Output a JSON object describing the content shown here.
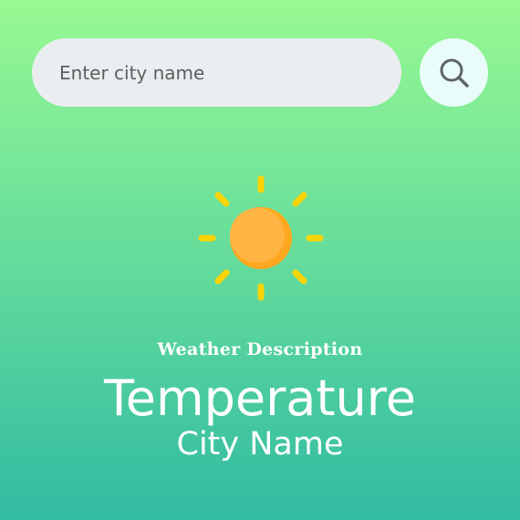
{
  "search": {
    "placeholder": "Enter city name",
    "value": "",
    "button_icon": "search-icon"
  },
  "weather": {
    "icon": "sun-icon",
    "description": "Weather Description",
    "temperature": "Temperature",
    "city": "City Name"
  },
  "colors": {
    "background_top": "#98f991",
    "background_bottom": "#31bba3",
    "input_background": "#eaeef0",
    "button_background": "#e9fcf9",
    "sun_body": "#ffb13d",
    "sun_rays": "#ffd400",
    "text": "#ffffff"
  }
}
